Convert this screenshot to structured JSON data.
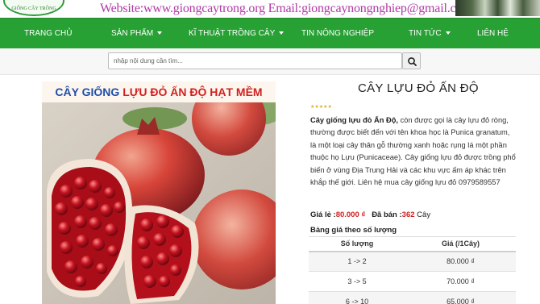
{
  "banner": {
    "logo_text": "GIỐNG CÂY TRỒNG",
    "contact": "Website:www.giongcaytrong.org Email:giongcaynongnghiep@gmail.com"
  },
  "nav": {
    "items": [
      {
        "label": "TRANG CHỦ",
        "dropdown": false
      },
      {
        "label": "SẢN PHẨM",
        "dropdown": true
      },
      {
        "label": "KĨ THUẬT TRỒNG CÂY",
        "dropdown": true
      },
      {
        "label": "TIN NÔNG NGHIỆP",
        "dropdown": false
      },
      {
        "label": "TIN TỨC",
        "dropdown": true
      },
      {
        "label": "LIÊN HỆ",
        "dropdown": false
      }
    ],
    "bg_color": "#27a034"
  },
  "search": {
    "placeholder": "nhập nội dung cần tìm...",
    "button_icon": "search-icon"
  },
  "product_image": {
    "header_part1": "CÂY GIỐNG ",
    "header_part2": "LỰU ĐỎ ẤN ĐỘ HẠT MỀM"
  },
  "product": {
    "title": "CÂY LỰU ĐỎ ẤN ĐỘ",
    "rating_stars": "★★★★★",
    "desc_bold": "Cây giống lựu đỏ Ấn Độ,",
    "desc_rest": " còn được gọi là cây lựu đỏ ròng, thường được biết đến với tên khoa học là Punica granatum, là một loại cây thân gỗ thường xanh hoặc rụng lá một phần thuộc họ Lựu (Punicaceae). Cây giống lựu đỏ được trồng phổ biến ở vùng Địa Trung Hải và các khu vực ấm áp khác trên khắp thế giới. Liên hệ mua cây giống lựu đỏ 0979589557",
    "price_label": "Giá lẻ :",
    "price_value": "80.000 ₫",
    "sold_label": "Đã bán :",
    "sold_value": "362",
    "sold_unit": " Cây",
    "tier_title": "Bảng giá theo số lượng",
    "tier_headers": [
      "Số lượng",
      "Giá (/1Cây)"
    ],
    "tiers": [
      {
        "qty": "1 -> 2",
        "price": "80.000 ₫"
      },
      {
        "qty": "3 -> 5",
        "price": "70.000 ₫"
      },
      {
        "qty": "6 -> 10",
        "price": "65.000 ₫"
      }
    ]
  }
}
